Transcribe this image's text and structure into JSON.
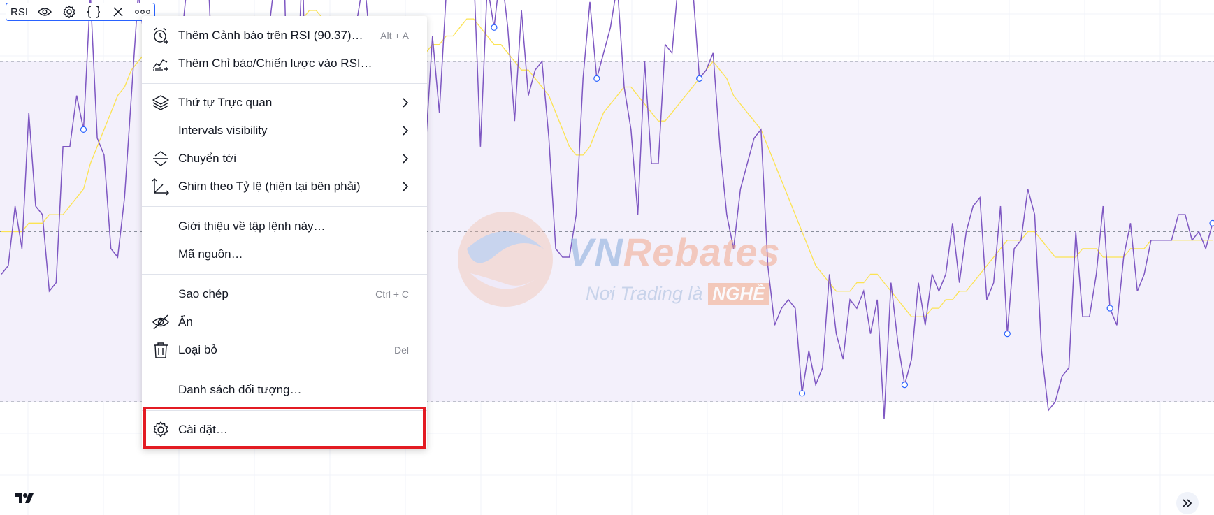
{
  "legend": {
    "name": "RSI"
  },
  "menu": {
    "items": [
      {
        "label": "Thêm Cảnh báo trên RSI (90.37)…",
        "shortcut": "Alt + A"
      },
      {
        "label": "Thêm Chỉ báo/Chiến lược vào RSI…"
      },
      {
        "label": "Thứ tự Trực quan"
      },
      {
        "label": "Intervals visibility"
      },
      {
        "label": "Chuyển tới"
      },
      {
        "label": "Ghim theo Tỷ lệ (hiện tại bên phải)"
      },
      {
        "label": "Giới thiệu về tập lệnh này…"
      },
      {
        "label": "Mã nguồn…"
      },
      {
        "label": "Sao chép",
        "shortcut": "Ctrl + C"
      },
      {
        "label": "Ẩn"
      },
      {
        "label": "Loại bỏ",
        "shortcut": "Del"
      },
      {
        "label": "Danh sách đối tượng…"
      },
      {
        "label": "Cài đặt…"
      }
    ]
  },
  "watermark": {
    "title_a": "VN",
    "title_b": "Rebates",
    "subtitle": "Nơi Trading là",
    "badge": "NGHỀ"
  },
  "colors": {
    "rsi_line": "#7e57c2",
    "ma_line": "#fce352",
    "band_fill": "#f3f0fb",
    "highlight": "#e31b23"
  },
  "chart_data": {
    "type": "line",
    "series": [
      {
        "values": [
          45,
          46,
          53,
          48,
          64,
          53,
          52,
          43,
          44,
          60,
          60,
          66,
          62,
          78,
          61,
          59,
          48,
          47,
          54,
          66,
          78,
          72,
          48,
          61,
          64,
          71,
          70,
          78,
          90,
          85,
          84,
          66,
          72,
          67,
          65,
          58,
          56,
          62,
          63,
          73,
          80,
          92,
          58,
          62,
          82,
          45,
          50,
          64,
          65,
          68,
          71,
          73,
          75,
          80,
          71,
          56,
          57,
          72,
          62,
          62,
          72,
          73,
          60,
          73,
          64,
          78,
          79,
          80,
          87,
          81,
          60,
          79,
          74,
          81,
          74,
          63,
          76,
          66,
          69,
          70,
          61,
          48,
          47,
          47,
          52,
          68,
          77,
          68,
          71,
          74,
          79,
          67,
          62,
          52,
          70,
          58,
          58,
          72,
          71,
          80,
          82,
          79,
          68,
          69,
          71,
          60,
          52,
          48,
          55,
          58,
          61,
          62,
          46,
          39,
          41,
          42,
          41,
          31,
          36,
          32,
          34,
          45,
          38,
          35,
          42,
          41,
          43,
          38,
          42,
          28,
          44,
          37,
          32,
          35,
          44,
          39,
          45,
          43,
          45,
          51,
          44,
          50,
          53,
          54,
          42,
          44,
          53,
          38,
          48,
          49,
          55,
          52,
          36,
          29,
          30,
          33,
          34,
          50,
          40,
          40,
          45,
          53,
          41,
          39,
          47,
          51,
          43,
          45,
          49,
          49,
          49,
          49,
          52,
          52,
          49,
          50,
          48,
          51
        ]
      },
      {
        "values": [
          50,
          50,
          50,
          50,
          51,
          51,
          51,
          52,
          52,
          52,
          53,
          54,
          55,
          58,
          60,
          62,
          64,
          66,
          67,
          69,
          70,
          71,
          72,
          72,
          70,
          68,
          66,
          65,
          64,
          64,
          64,
          63,
          62,
          62,
          63,
          64,
          65,
          66,
          67,
          68,
          69,
          70,
          72,
          74,
          75,
          76,
          76,
          75,
          74,
          73,
          72,
          72,
          71,
          70,
          70,
          69,
          68,
          67,
          67,
          68,
          69,
          70,
          71,
          72,
          72,
          73,
          73,
          74,
          75,
          75,
          74,
          73,
          72,
          72,
          71,
          70,
          69,
          69,
          68,
          67,
          66,
          64,
          62,
          60,
          59,
          59,
          60,
          62,
          64,
          65,
          66,
          67,
          67,
          66,
          65,
          64,
          63,
          63,
          64,
          65,
          66,
          67,
          68,
          69,
          70,
          69,
          68,
          66,
          65,
          64,
          63,
          62,
          60,
          58,
          56,
          54,
          52,
          50,
          48,
          46,
          45,
          44,
          43,
          43,
          43,
          44,
          44,
          45,
          45,
          44,
          43,
          42,
          41,
          40,
          40,
          40,
          41,
          41,
          42,
          42,
          43,
          43,
          44,
          45,
          46,
          47,
          48,
          49,
          49,
          49,
          50,
          50,
          49,
          48,
          47,
          47,
          47,
          47,
          48,
          48,
          48,
          47,
          47,
          47,
          47,
          48,
          48,
          48,
          49,
          49,
          49,
          49,
          49,
          49,
          49,
          49,
          49,
          49
        ]
      }
    ],
    "ylim": [
      20,
      100
    ],
    "bands": [
      30,
      50,
      70
    ],
    "band_fill_range": [
      30,
      70
    ],
    "grid": true
  }
}
